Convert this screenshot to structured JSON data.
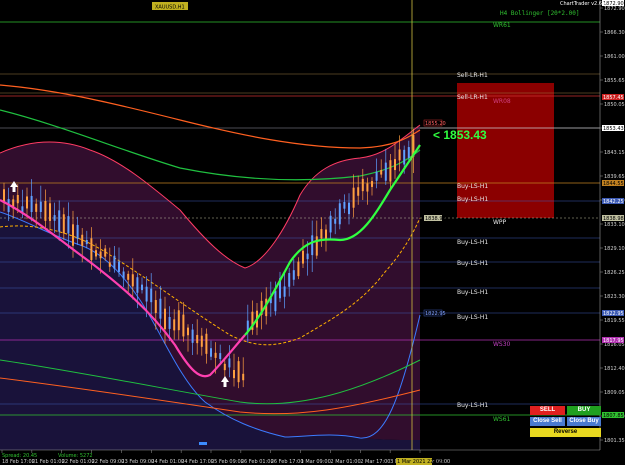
{
  "window": {
    "symbol_badge": "XAUUSD,H1",
    "indicator_label": "H4 Bollinger [20*2.00]",
    "watermark": "ChartTrader v2.6b",
    "current_price_big": "< 1853.43",
    "stats_left": "Spread: 20.45",
    "stats_mid": "Volume: 5272",
    "vline_time_label": "1 Mar 2021 22:00"
  },
  "colors": {
    "background": "#000000",
    "bull_candle": "#ff9f40",
    "bear_candle": "#5fa0ff",
    "sell_zone": "#8b0000",
    "bb_upper": "#ff3c64",
    "bb_lower": "#3c7bff",
    "ma_fast": "#ff40b0",
    "ma_fast_up": "#30ff40",
    "ma_dashed": "#ffb000",
    "wr_line": "#30c030",
    "vline": "#d0c040"
  },
  "price_axis": {
    "ticks": [
      "1872.90",
      "1866.30",
      "1861.00",
      "1855.65",
      "1850.05",
      "1846.65",
      "1843.15",
      "1839.65",
      "1835.90",
      "1833.10",
      "1829.10",
      "1826.25",
      "1823.30",
      "1819.55",
      "1816.05",
      "1812.40",
      "1809.05",
      "1805.70",
      "1801.35"
    ],
    "tags": {
      "ask": "1853.43",
      "bid": "1855.20",
      "wr08": "1857.45",
      "buy1": "1844.55",
      "buy2": "1842.25",
      "wpp": "1838.98",
      "sell1": "1822.95",
      "ws30": "1817.95",
      "ws61": "1807.85",
      "bottom": "1802.00"
    }
  },
  "time_axis": [
    "18 Feb 17:00",
    "21 Feb 01:00",
    "22 Feb 01:00",
    "22 Feb 09:00",
    "23 Feb 09:00",
    "24 Feb 01:00",
    "24 Feb 17:00",
    "25 Feb 09:00",
    "26 Feb 01:00",
    "26 Feb 17:00",
    "1 Mar 09:00",
    "2 Mar 01:00",
    "2 Mar 17:00",
    "3 Mar 01:00",
    "4 Mar 09:00"
  ],
  "levels": {
    "wr61": "WR61",
    "sell_lr_1": "Sell-LR-H1",
    "sell_lr_2": "Sell-LR-H1",
    "wr08": "WR08",
    "buy_ls_1": "Buy-LS-H1",
    "buy_ls_2": "Buy-LS-H1",
    "wpp": "WPP",
    "buy_ls_3": "Buy-LS-H1",
    "buy_ls_4": "Buy-LS-H1",
    "buy_ls_5": "Buy-LS-H1",
    "buy_ls_6": "Buy-LS-H1",
    "ws30": "WS30",
    "buy_ls_7": "Buy-LS-H1",
    "ws61": "WS61"
  },
  "buttons": {
    "sell": "SELL",
    "buy": "BUY",
    "close_sell": "Close Sell",
    "close_buy": "Close Buy",
    "reverse": "Reverse"
  }
}
